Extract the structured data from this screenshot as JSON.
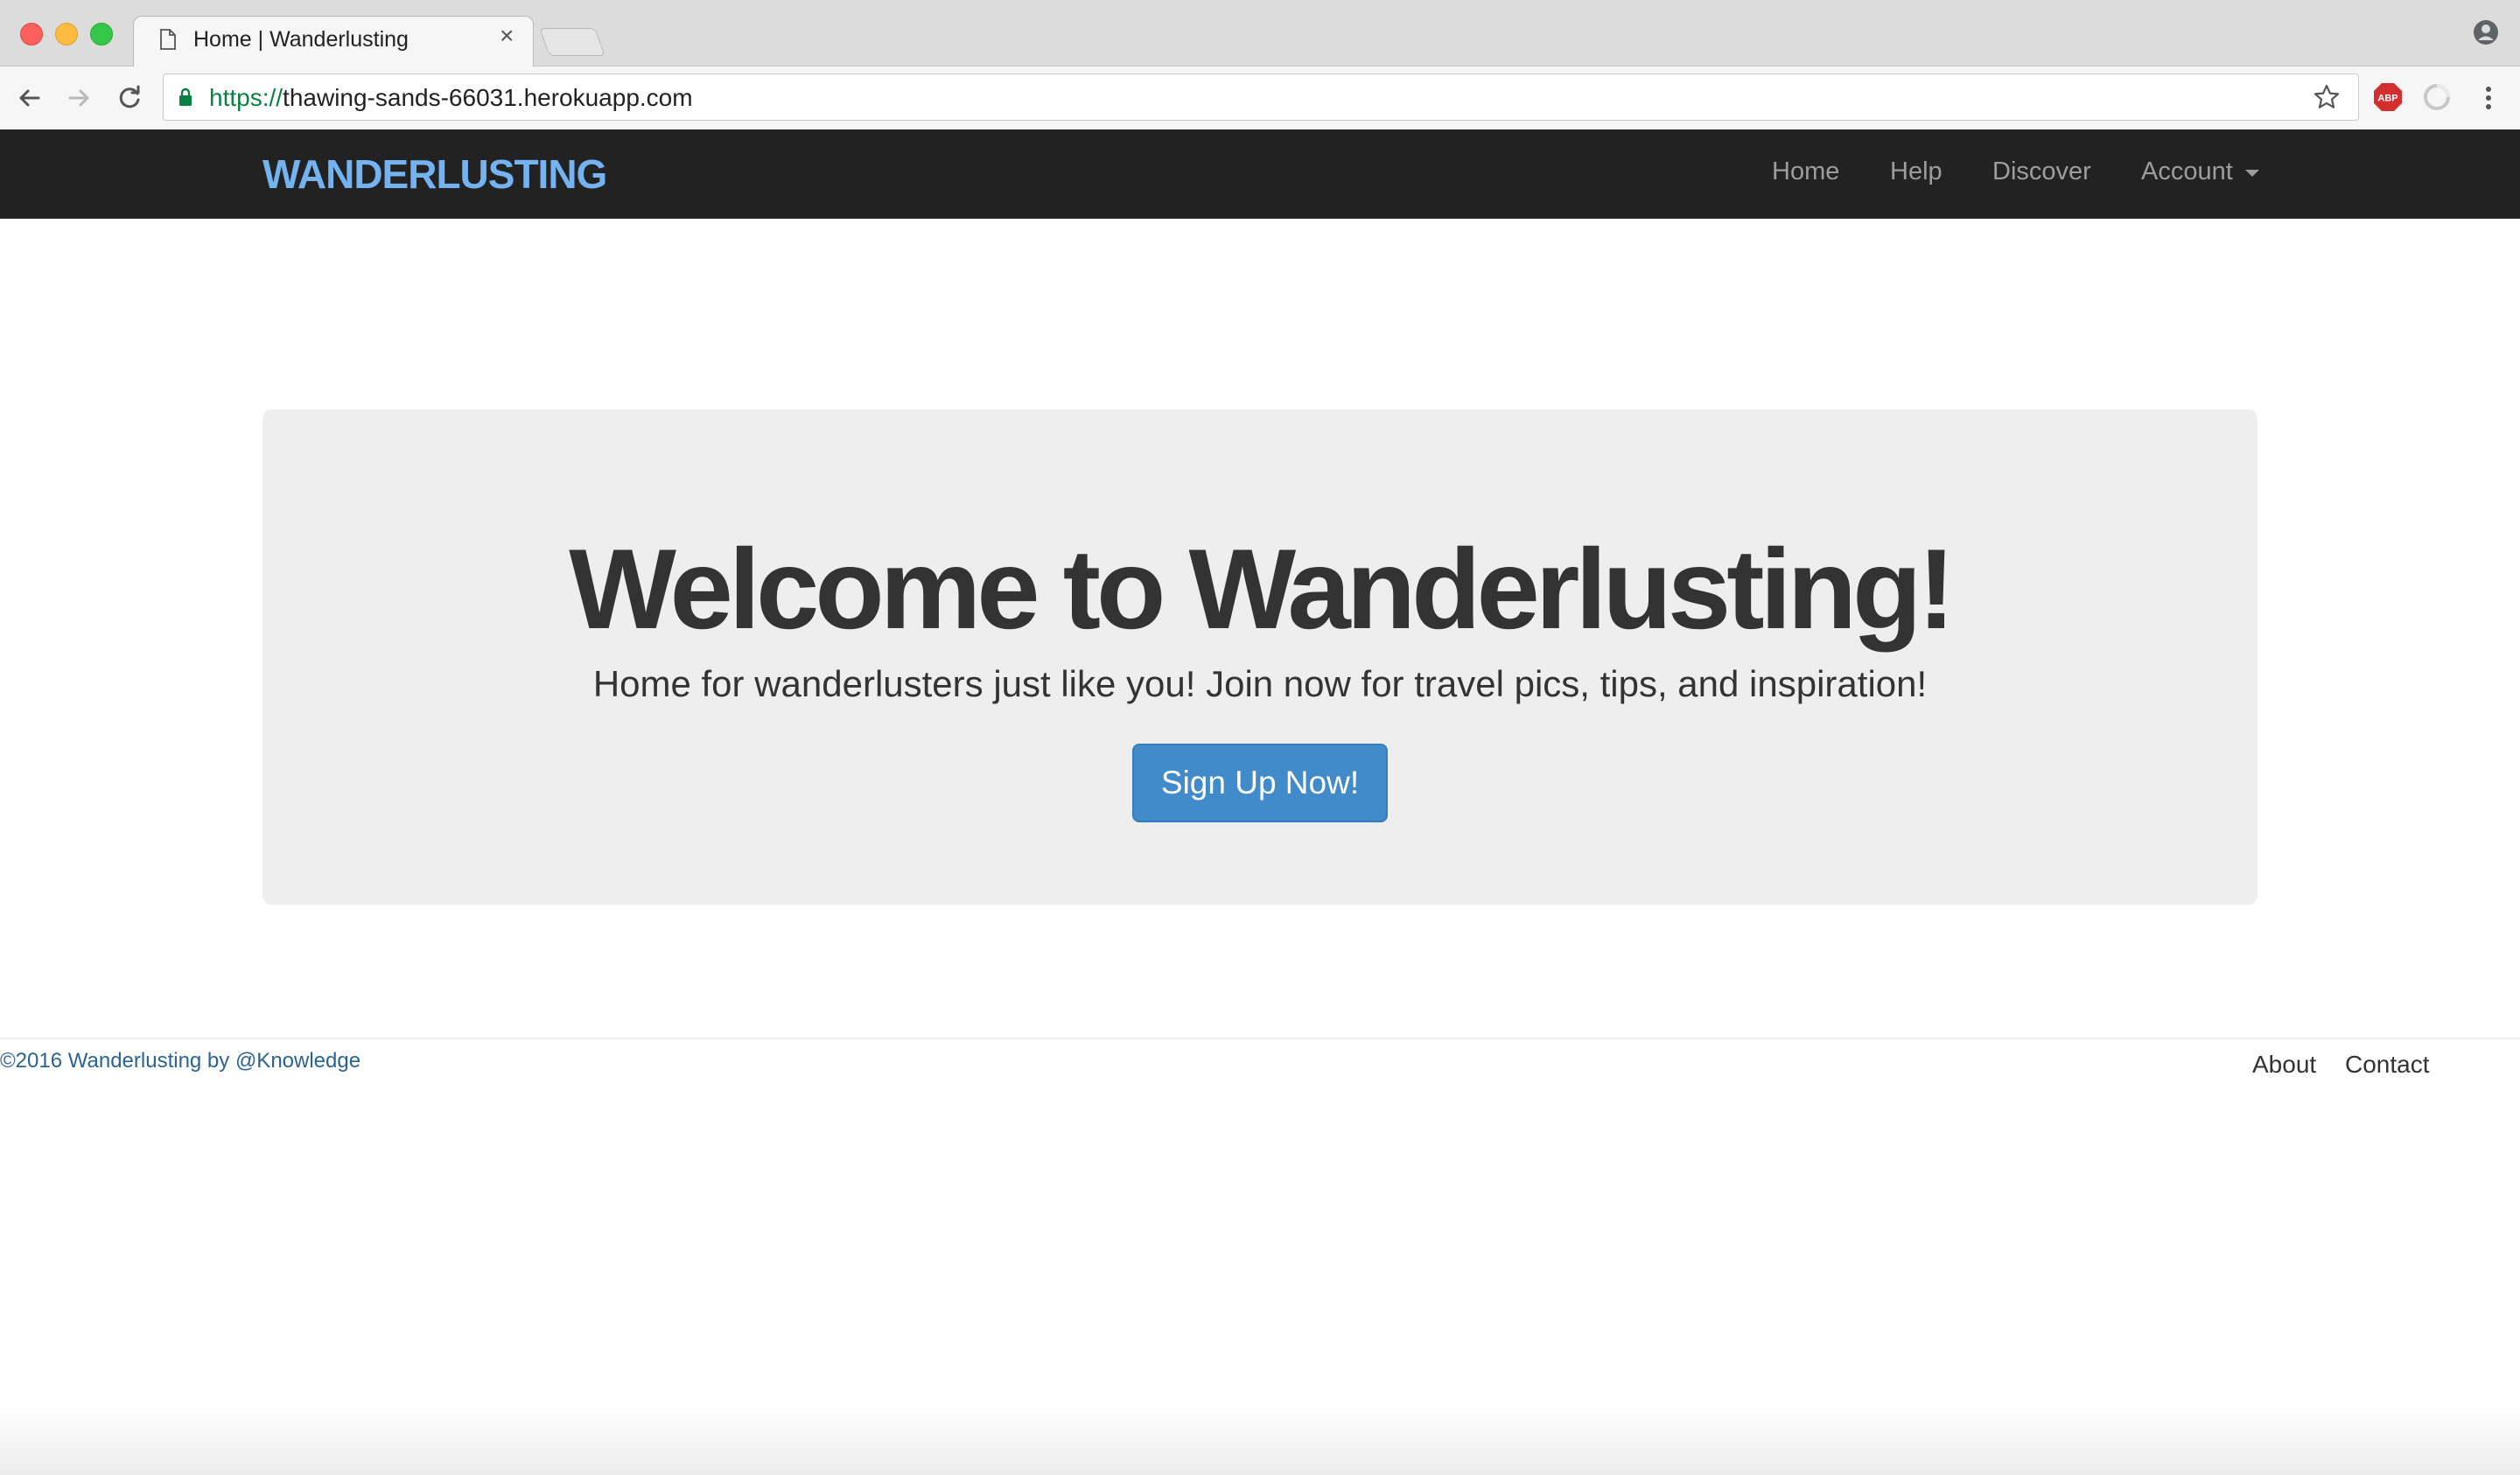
{
  "browser": {
    "tab_title": "Home | Wanderlusting",
    "tab_close": "×",
    "url_scheme": "https://",
    "url_host": "thawing-sands-66031.herokuapp.com",
    "abp_label": "ABP"
  },
  "navbar": {
    "brand": "WANDERLUSTING",
    "links": {
      "home": "Home",
      "help": "Help",
      "discover": "Discover",
      "account": "Account"
    }
  },
  "hero": {
    "title": "Welcome to Wanderlusting!",
    "subtitle": "Home for wanderlusters just like you! Join now for travel pics, tips, and inspiration!",
    "cta": "Sign Up Now!"
  },
  "footer": {
    "copyright": "©2016 Wanderlusting by @Knowledge",
    "about": "About",
    "contact": "Contact"
  },
  "colors": {
    "navbar_bg": "#222222",
    "brand": "#74b3f0",
    "cta": "#428bca",
    "jumbotron_bg": "#eeeeee"
  }
}
